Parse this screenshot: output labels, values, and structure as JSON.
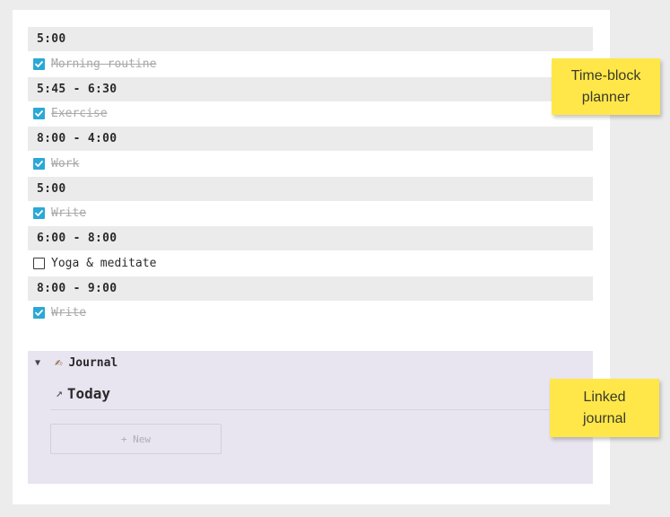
{
  "schedule": [
    {
      "time": "5:00",
      "task": "Morning routine",
      "done": true
    },
    {
      "time": "5:45 - 6:30",
      "task": "Exercise",
      "done": true
    },
    {
      "time": "8:00 - 4:00",
      "task": "Work",
      "done": true
    },
    {
      "time": "5:00",
      "task": "Write",
      "done": true
    },
    {
      "time": "6:00 - 8:00",
      "task": "Yoga & meditate",
      "done": false
    },
    {
      "time": "8:00 - 9:00",
      "task": "Write",
      "done": true
    }
  ],
  "journal": {
    "toggle_icon": "triangle-down-icon",
    "emoji_icon": "writing-hand-icon",
    "title": "Journal",
    "link_icon": "arrow-up-right-icon",
    "today_label": "Today",
    "new_label": "+ New",
    "background": "#e8e4f0"
  },
  "stickies": {
    "planner_line1": "Time-block",
    "planner_line2": "planner",
    "journal_line1": "Linked",
    "journal_line2": "journal"
  },
  "colors": {
    "checkbox_checked": "#2ba8d6",
    "time_row_bg": "#ebebeb",
    "sticky": "#ffe74a"
  }
}
